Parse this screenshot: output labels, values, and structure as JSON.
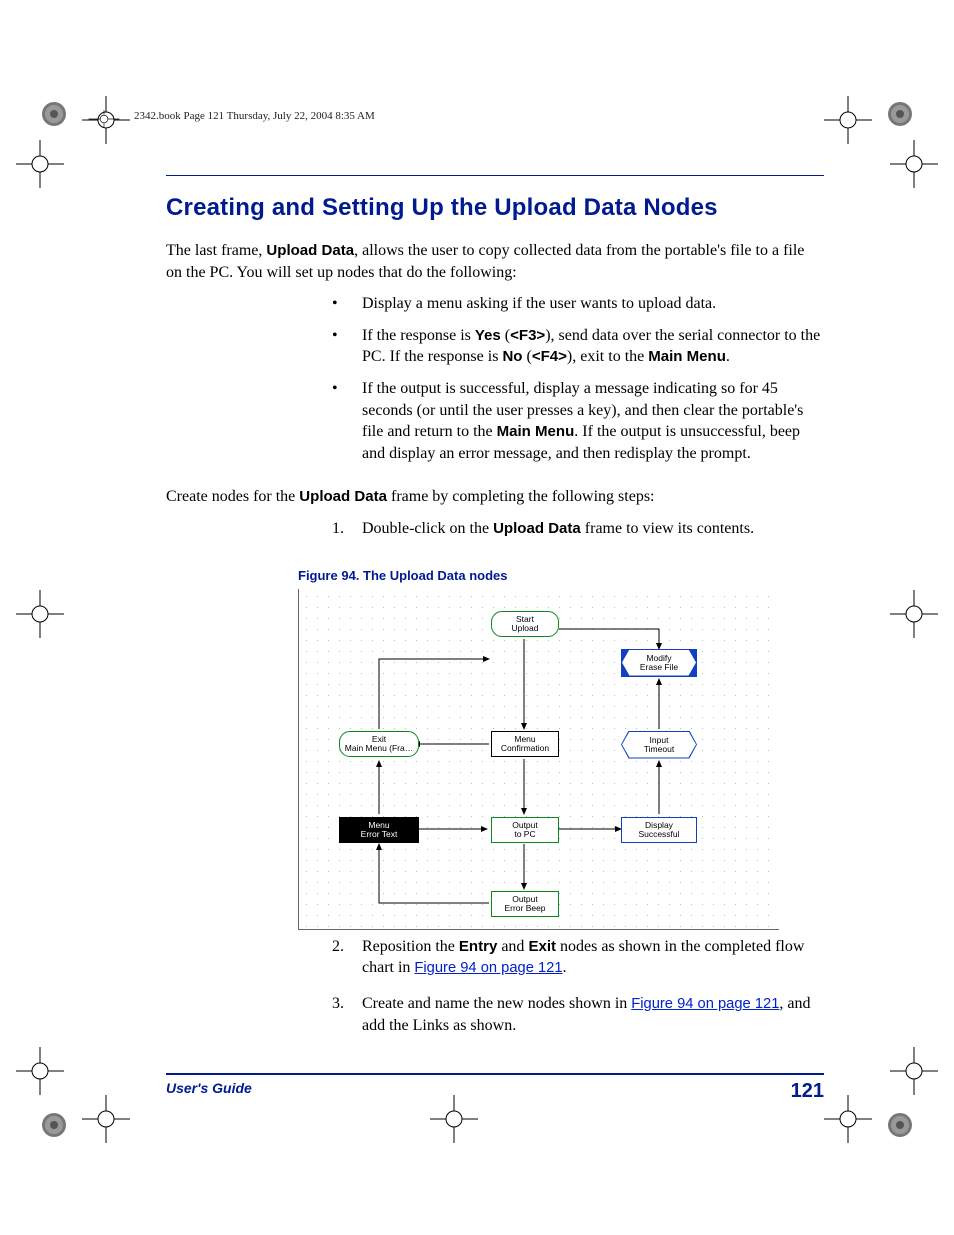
{
  "header": {
    "slug": "2342.book  Page 121  Thursday, July 22, 2004  8:35 AM"
  },
  "title": "Creating and Setting Up the Upload Data Nodes",
  "intro": {
    "pre": "The last frame, ",
    "frame_name": "Upload Data",
    "post": ", allows the user to copy collected data from the portable's file to a file on the PC. You will set up nodes that do the following:"
  },
  "bullets": {
    "b1": "Display a menu asking if the user wants to upload data.",
    "b2": {
      "s1": "If the response is ",
      "yes": "Yes",
      "s2": " (",
      "f3": "<F3>",
      "s3": "), send data over the serial connector to the PC. If the response is ",
      "no": "No",
      "s4": " (",
      "f4": "<F4>",
      "s5": "), exit to the ",
      "mm": "Main Menu",
      "s6": "."
    },
    "b3": {
      "s1": "If the output is successful, display a message indicating so for 45 seconds (or until the user presses a key), and then clear the portable's file and return to the ",
      "mm": "Main Menu",
      "s2": ". If the output is unsuccessful, beep and display an error message, and then redisplay the prompt."
    }
  },
  "lead_in": {
    "s1": "Create nodes for the ",
    "ud": "Upload Data",
    "s2": " frame by completing the following steps:"
  },
  "steps": {
    "s1": {
      "a": "Double-click on the ",
      "b": "Upload Data",
      "c": " frame to view its contents."
    },
    "s2": {
      "a": "Reposition the ",
      "entry": "Entry",
      "b": " and ",
      "exit": "Exit",
      "c": " nodes as shown in the completed flow chart in ",
      "link": "Figure 94 on page 121",
      "d": "."
    },
    "s3": {
      "a": "Create and name the new nodes shown in ",
      "link": "Figure 94 on page 121",
      "b": ", and add the Links as shown."
    }
  },
  "figure": {
    "caption": "Figure 94. The Upload Data nodes",
    "nodes": {
      "start_upload": "Start\nUpload",
      "modify_erase": "Modify\nErase File",
      "exit_main": "Exit\nMain Menu (Fra…",
      "menu_conf": "Menu\nConfirmation",
      "input_timeout": "Input\nTimeout",
      "menu_error": "Menu\nError Text",
      "output_pc": "Output\nto PC",
      "display_succ": "Display\nSuccessful",
      "output_beep": "Output\nError Beep"
    }
  },
  "footer": {
    "guide": "User's Guide",
    "page": "121"
  }
}
